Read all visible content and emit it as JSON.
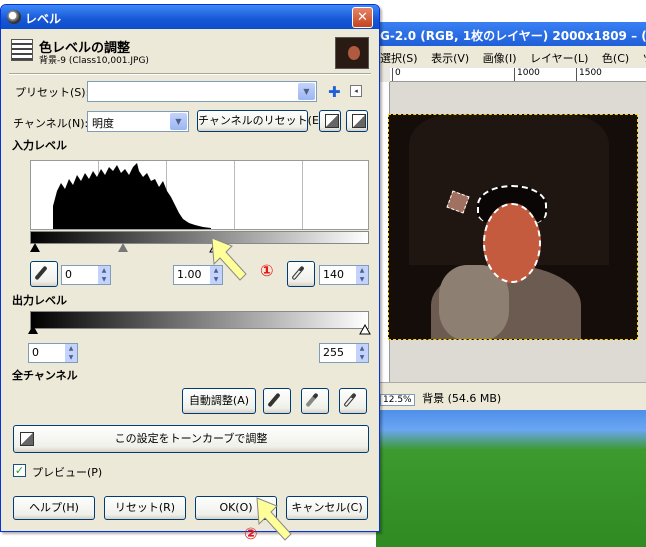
{
  "bg_window": {
    "title": "G-2.0 (RGB, 1枚のレイヤー) 2000x1809 – (",
    "menu": [
      "選択(S)",
      "表示(V)",
      "画像(I)",
      "レイヤー(L)",
      "色(C)",
      "ツ"
    ],
    "ruler": [
      "0",
      "1000",
      "1500"
    ],
    "zoom": "12.5%",
    "status_text": "背景 (54.6 MB)"
  },
  "dialog": {
    "title": "レベル",
    "header_title": "色レベルの調整",
    "header_sub": "背景-9 (Class10,001.JPG)",
    "preset_label": "プリセット(S):",
    "preset_value": "",
    "channel_label": "チャンネル(N):",
    "channel_value": "明度",
    "reset_channel": "チャンネルのリセット(E)",
    "input_levels": "入力レベル",
    "input_low": "0",
    "input_gamma": "1.00",
    "input_high": "140",
    "output_levels": "出力レベル",
    "output_low": "0",
    "output_high": "255",
    "all_channels": "全チャンネル",
    "auto": "自動調整(A)",
    "curves": "この設定をトーンカーブで調整",
    "preview": "プレビュー(P)",
    "preview_checked": true,
    "help": "ヘルプ(H)",
    "reset": "リセット(R)",
    "ok": "OK(O)",
    "cancel": "キャンセル(C)"
  },
  "annotations": [
    "①",
    "②"
  ],
  "colors": {
    "title_blue": "#1757d6",
    "annotation_red": "#e81818",
    "annotation_arrow": "#ffff99"
  }
}
